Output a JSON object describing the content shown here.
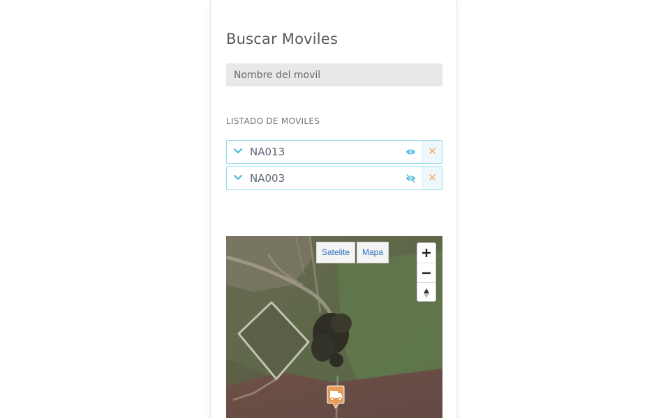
{
  "search": {
    "title": "Buscar Moviles",
    "placeholder": "Nombre del movil"
  },
  "list": {
    "label": "LISTADO DE MOVILES",
    "vehicles": [
      {
        "name": "NA013",
        "visible": true
      },
      {
        "name": "NA003",
        "visible": false
      }
    ]
  },
  "map": {
    "type_buttons": [
      "Satelite",
      "Mapa"
    ],
    "controls": [
      "zoom-in",
      "zoom-out",
      "reset-bearing"
    ],
    "marker": "truck-icon"
  },
  "colors": {
    "accent": "#4bb8dd",
    "remove": "#f2b482",
    "marker": "#e89c5a",
    "link": "#2a6fc2"
  }
}
